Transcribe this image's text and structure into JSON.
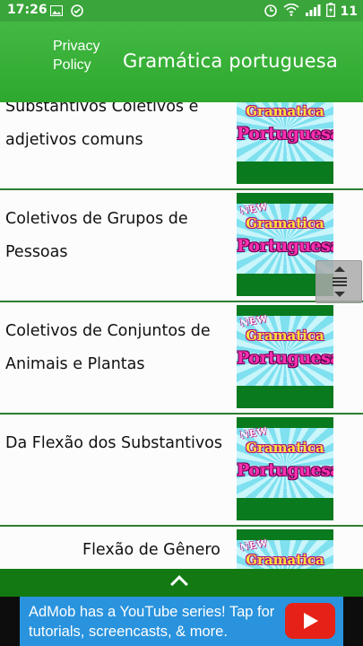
{
  "status_bar": {
    "time": "17:26",
    "battery": "11",
    "left_icons": [
      "image-icon",
      "check-circle-icon"
    ],
    "right_icons": [
      "alarm-icon",
      "wifi-icon",
      "signal-icon",
      "battery-charging-icon"
    ]
  },
  "app_bar": {
    "privacy_label": "Privacy Policy",
    "title": "Gramática portuguesa",
    "color": "#3aa53a"
  },
  "thumbnail": {
    "new_text": "NEW",
    "gramatica_text": "Gramatica",
    "portuguesa_text": "Portuguesa"
  },
  "list": {
    "items": [
      {
        "label": "Substantivos Coletivos e adjetivos comuns"
      },
      {
        "label": "Coletivos de Grupos de Pessoas"
      },
      {
        "label": "Coletivos de Conjuntos de Animais e Plantas"
      },
      {
        "label": "Da Flexão dos Substantivos"
      },
      {
        "label": "Flexão de Gênero"
      }
    ]
  },
  "ad": {
    "text": "AdMob has a YouTube series! Tap for tutorials, screencasts, & more.",
    "bg_color": "#2a93dd",
    "play_color": "#e62117"
  }
}
